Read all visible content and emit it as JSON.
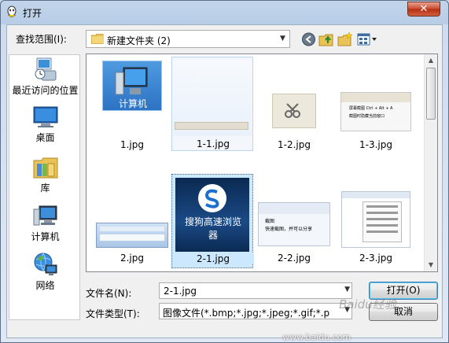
{
  "window": {
    "title": "打开",
    "close_label": "✕"
  },
  "lookin": {
    "label": "查找范围(I):",
    "value": "新建文件夹 (2)"
  },
  "toolbar": {
    "back": "back-icon",
    "up": "up-folder-icon",
    "new_folder": "new-folder-icon",
    "view_menu": "view-menu-icon"
  },
  "places": [
    {
      "label": "最近访问的位置",
      "icon": "recent-places-icon"
    },
    {
      "label": "桌面",
      "icon": "desktop-icon"
    },
    {
      "label": "库",
      "icon": "library-icon"
    },
    {
      "label": "计算机",
      "icon": "computer-icon"
    },
    {
      "label": "网络",
      "icon": "network-icon"
    }
  ],
  "files": [
    {
      "name": "1.jpg",
      "thumb_text": "计算机"
    },
    {
      "name": "1-1.jpg"
    },
    {
      "name": "1-2.jpg"
    },
    {
      "name": "1-3.jpg",
      "thumb_text": "屏幕截图 Ctrl + Alt + A",
      "thumb_text2": "截图时隐藏当前窗口"
    },
    {
      "name": "2.jpg"
    },
    {
      "name": "2-1.jpg",
      "thumb_text": "搜狗高速浏览器"
    },
    {
      "name": "2-2.jpg",
      "thumb_text": "截图",
      "thumb_text2": "快速截图，并可以分享"
    },
    {
      "name": "2-3.jpg"
    }
  ],
  "filename": {
    "label": "文件名(N):",
    "value": "2-1.jpg"
  },
  "filetype": {
    "label": "文件类型(T):",
    "value": "图像文件(*.bmp;*.jpg;*.jpeg;*.gif;*.p"
  },
  "buttons": {
    "open": "打开(O)",
    "cancel": "取消"
  },
  "watermark": {
    "text": "www.baidu.com",
    "logo": "Baidu经验"
  },
  "colors": {
    "selection": "#cce8ff",
    "accent": "#3d6ea8"
  }
}
